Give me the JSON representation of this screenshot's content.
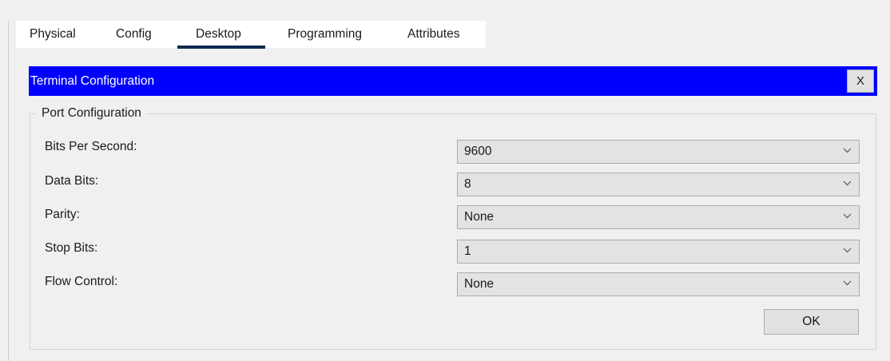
{
  "tabs": [
    {
      "label": "Physical",
      "active": false
    },
    {
      "label": "Config",
      "active": false
    },
    {
      "label": "Desktop",
      "active": true
    },
    {
      "label": "Programming",
      "active": false
    },
    {
      "label": "Attributes",
      "active": false
    }
  ],
  "dialog": {
    "title": "Terminal Configuration",
    "close_label": "X",
    "title_bar_color": "#0000ff",
    "group_title": "Port Configuration",
    "fields": [
      {
        "label": "Bits Per Second:",
        "value": "9600"
      },
      {
        "label": "Data Bits:",
        "value": "8"
      },
      {
        "label": "Parity:",
        "value": "None"
      },
      {
        "label": "Stop Bits:",
        "value": "1"
      },
      {
        "label": "Flow Control:",
        "value": "None"
      }
    ],
    "ok_label": "OK"
  },
  "icons": {
    "dropdown": "chevron-down-icon"
  }
}
